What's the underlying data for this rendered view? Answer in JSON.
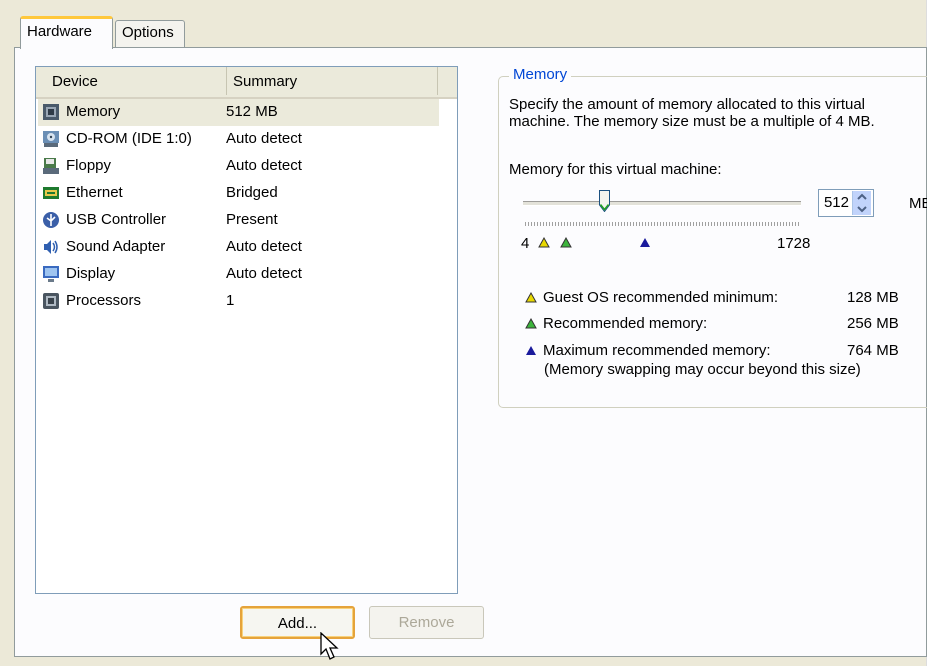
{
  "tabs": [
    {
      "label": "Hardware",
      "active": true
    },
    {
      "label": "Options",
      "active": false
    }
  ],
  "device_list": {
    "columns": [
      "Device",
      "Summary"
    ],
    "rows": [
      {
        "icon": "memory-icon",
        "name": "Memory",
        "summary": "512 MB",
        "selected": true
      },
      {
        "icon": "cdrom-icon",
        "name": "CD-ROM (IDE 1:0)",
        "summary": "Auto detect",
        "selected": false
      },
      {
        "icon": "floppy-icon",
        "name": "Floppy",
        "summary": "Auto detect",
        "selected": false
      },
      {
        "icon": "ethernet-icon",
        "name": "Ethernet",
        "summary": "Bridged",
        "selected": false
      },
      {
        "icon": "usb-icon",
        "name": "USB Controller",
        "summary": "Present",
        "selected": false
      },
      {
        "icon": "sound-icon",
        "name": "Sound Adapter",
        "summary": "Auto detect",
        "selected": false
      },
      {
        "icon": "display-icon",
        "name": "Display",
        "summary": "Auto detect",
        "selected": false
      },
      {
        "icon": "processor-icon",
        "name": "Processors",
        "summary": "1",
        "selected": false
      }
    ]
  },
  "buttons": {
    "add": "Add...",
    "remove": "Remove"
  },
  "memory": {
    "group_title": "Memory",
    "description": "Specify the amount of memory allocated to this virtual machine. The memory size must be a multiple of 4 MB.",
    "field_label": "Memory for this virtual machine:",
    "value": "512",
    "unit": "MB",
    "scale_min": "4",
    "scale_max": "1728",
    "legend": [
      {
        "color": "#e8d800",
        "label": "Guest OS recommended minimum:",
        "value": "128 MB"
      },
      {
        "color": "#3cb43c",
        "label": "Recommended memory:",
        "value": "256 MB"
      },
      {
        "color": "#1a1a9c",
        "label": "Maximum recommended memory:",
        "value": "764 MB"
      }
    ],
    "note": "(Memory swapping may occur beyond this size)"
  },
  "colors": {
    "accent_tab": "#ffc83c",
    "group_title": "#0046d5",
    "selection": "#ebeadb"
  }
}
